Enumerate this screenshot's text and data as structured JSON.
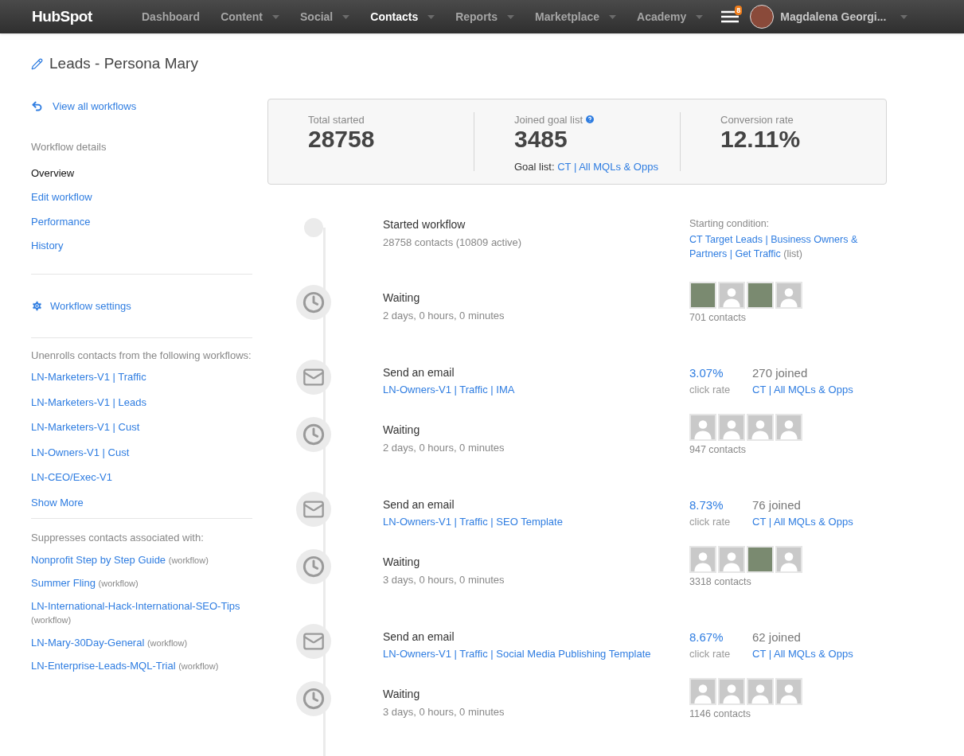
{
  "nav": {
    "logo": "HubSpot",
    "items": [
      {
        "label": "Dashboard",
        "dropdown": false,
        "selected": false
      },
      {
        "label": "Content",
        "dropdown": true,
        "selected": false
      },
      {
        "label": "Social",
        "dropdown": true,
        "selected": false
      },
      {
        "label": "Contacts",
        "dropdown": true,
        "selected": true
      },
      {
        "label": "Reports",
        "dropdown": true,
        "selected": false
      },
      {
        "label": "Marketplace",
        "dropdown": true,
        "selected": false
      },
      {
        "label": "Academy",
        "dropdown": true,
        "selected": false
      }
    ],
    "notification_count": "8",
    "user_name": "Magdalena Georgi..."
  },
  "page_title": "Leads - Persona Mary",
  "sidebar": {
    "back_link": "View all workflows",
    "details_heading": "Workflow details",
    "items": [
      {
        "label": "Overview",
        "selected": true
      },
      {
        "label": "Edit workflow",
        "selected": false
      },
      {
        "label": "Performance",
        "selected": false
      },
      {
        "label": "History",
        "selected": false
      }
    ],
    "settings_link": "Workflow settings",
    "unenroll_heading": "Unenrolls contacts from the following workflows:",
    "unenroll_workflows": [
      "LN-Marketers-V1 | Traffic",
      "LN-Marketers-V1 | Leads",
      "LN-Marketers-V1 | Cust",
      "LN-Owners-V1 | Cust",
      "LN-CEO/Exec-V1"
    ],
    "show_more": "Show More",
    "suppress_heading": "Suppresses contacts associated with:",
    "suppressed": [
      {
        "name": "Nonprofit Step by Step Guide",
        "tag": "(workflow)"
      },
      {
        "name": "Summer Fling",
        "tag": "(workflow)"
      },
      {
        "name": "LN-International-Hack-International-SEO-Tips",
        "tag": "(workflow)"
      },
      {
        "name": "LN-Mary-30Day-General",
        "tag": "(workflow)"
      },
      {
        "name": "LN-Enterprise-Leads-MQL-Trial",
        "tag": "(workflow)"
      }
    ]
  },
  "stats": [
    {
      "label": "Total started",
      "value": "28758",
      "help": false
    },
    {
      "label": "Joined goal list",
      "value": "3485",
      "help": true,
      "goal_label": "Goal list:",
      "goal_link": "CT | All MQLs & Opps"
    },
    {
      "label": "Conversion rate",
      "value": "12.11%",
      "help": false
    }
  ],
  "steps": [
    {
      "kind": "started",
      "title": "Started workflow",
      "detail": "28758 contacts (10809 active)",
      "condition_label": "Starting condition:",
      "condition_link": "CT Target Leads | Business Owners & Partners | Get Traffic",
      "condition_tag": "(list)"
    },
    {
      "kind": "wait",
      "title": "Waiting",
      "detail": "2 days, 0 hours, 0 minutes",
      "avatars": [
        {
          "photo": true
        },
        {
          "photo": false
        },
        {
          "photo": true
        },
        {
          "photo": false
        }
      ],
      "contacts": "701 contacts"
    },
    {
      "kind": "email",
      "title": "Send an email",
      "link": "LN-Owners-V1 | Traffic | IMA",
      "rate": "3.07%",
      "rate_label": "click rate",
      "joined": "270 joined",
      "joined_link": "CT | All MQLs & Opps"
    },
    {
      "kind": "wait",
      "title": "Waiting",
      "detail": "2 days, 0 hours, 0 minutes",
      "avatars": [
        {
          "photo": false
        },
        {
          "photo": false
        },
        {
          "photo": false
        },
        {
          "photo": false
        }
      ],
      "contacts": "947 contacts"
    },
    {
      "kind": "email",
      "title": "Send an email",
      "link": "LN-Owners-V1 | Traffic | SEO Template",
      "rate": "8.73%",
      "rate_label": "click rate",
      "joined": "76 joined",
      "joined_link": "CT | All MQLs & Opps"
    },
    {
      "kind": "wait",
      "title": "Waiting",
      "detail": "3 days, 0 hours, 0 minutes",
      "avatars": [
        {
          "photo": false
        },
        {
          "photo": false
        },
        {
          "photo": true
        },
        {
          "photo": false
        }
      ],
      "contacts": "3318 contacts"
    },
    {
      "kind": "email",
      "title": "Send an email",
      "link": "LN-Owners-V1 | Traffic | Social Media Publishing Template",
      "rate": "8.67%",
      "rate_label": "click rate",
      "joined": "62 joined",
      "joined_link": "CT | All MQLs & Opps"
    },
    {
      "kind": "wait",
      "title": "Waiting",
      "detail": "3 days, 0 hours, 0 minutes",
      "avatars": [
        {
          "photo": false
        },
        {
          "photo": false
        },
        {
          "photo": false
        },
        {
          "photo": false
        }
      ],
      "contacts": "1146 contacts"
    }
  ]
}
